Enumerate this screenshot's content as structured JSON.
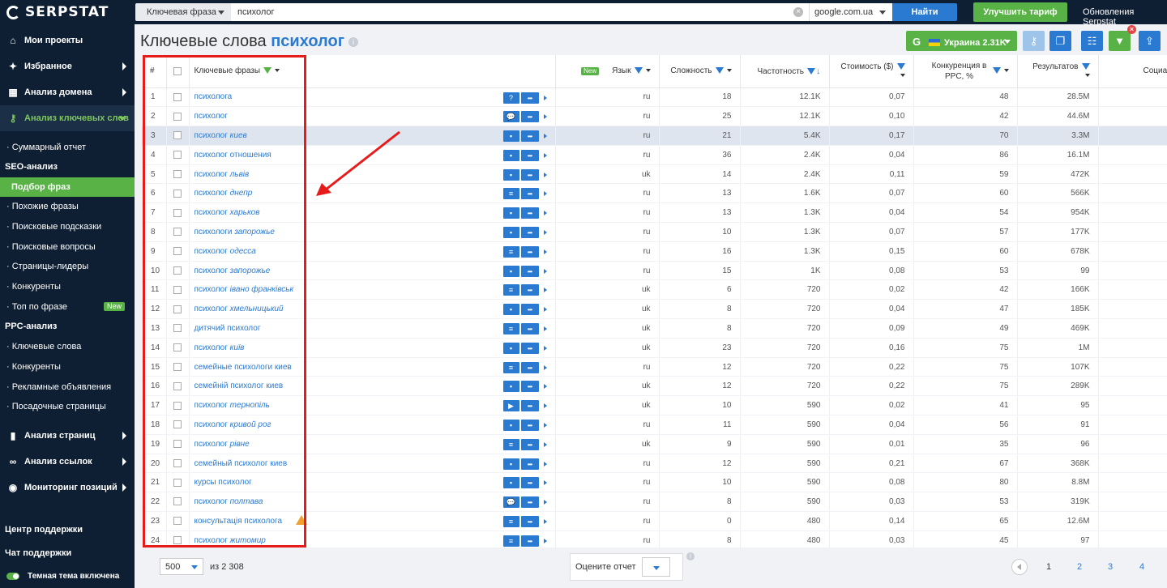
{
  "topbar": {
    "logo": "SERPSTAT",
    "search_type": "Ключевая фраза",
    "search_value": "психолог",
    "database": "google.com.ua",
    "find_label": "Найти",
    "upgrade_label": "Улучшить тариф",
    "updates_label": "Обновления Serpstat"
  },
  "sidebar": {
    "nav": [
      {
        "label": "Мои проекты",
        "icon": "home-icon"
      },
      {
        "label": "Избранное",
        "icon": "pin-icon"
      },
      {
        "label": "Анализ домена",
        "icon": "chart-icon"
      },
      {
        "label": "Анализ ключевых слов",
        "icon": "key-icon"
      }
    ],
    "keyword_items": [
      "Суммарный отчет",
      "SEO-анализ",
      "Подбор фраз",
      "Похожие фразы",
      "Поисковые подсказки",
      "Поисковые вопросы",
      "Страницы-лидеры",
      "Конкуренты",
      "Топ по фразе",
      "PPC-анализ",
      "Ключевые слова",
      "Конкуренты",
      "Рекламные объявления",
      "Посадочные страницы"
    ],
    "new_badge": "New",
    "nav2": [
      {
        "label": "Анализ страниц",
        "icon": "bar-icon"
      },
      {
        "label": "Анализ ссылок",
        "icon": "link-icon"
      },
      {
        "label": "Мониторинг позиций",
        "icon": "monitor-icon"
      }
    ],
    "support_center": "Центр поддержки",
    "support_chat": "Чат поддержки",
    "dark_theme": "Темная тема включена"
  },
  "header": {
    "title": "Ключевые слова",
    "keyword": "психолог",
    "region": "Украина 2.31K"
  },
  "table": {
    "columns": {
      "num": "#",
      "keyword": "Ключевые фразы",
      "new": "New",
      "lang": "Язык",
      "difficulty": "Сложность",
      "volume": "Частотность",
      "cost": "Стоимость ($)",
      "competition": "Конкуренция в PPC, %",
      "results": "Результатов",
      "social": "Социал"
    },
    "rows": [
      {
        "n": "1",
        "kw": "психолога",
        "lang": "ru",
        "diff": "18",
        "vol": "12.1K",
        "cost": "0,07",
        "comp": "48",
        "res": "28.5M",
        "a": "?"
      },
      {
        "n": "2",
        "kw": "психолог",
        "lang": "ru",
        "diff": "25",
        "vol": "12.1K",
        "cost": "0,10",
        "comp": "42",
        "res": "44.6M",
        "a": "💬"
      },
      {
        "n": "3",
        "kw": "психолог киев",
        "lang": "ru",
        "diff": "21",
        "vol": "5.4K",
        "cost": "0,17",
        "comp": "70",
        "res": "3.3M",
        "a": "▪"
      },
      {
        "n": "4",
        "kw": "психолог отношения",
        "lang": "ru",
        "diff": "36",
        "vol": "2.4K",
        "cost": "0,04",
        "comp": "86",
        "res": "16.1M",
        "a": "▪"
      },
      {
        "n": "5",
        "kw": "психолог львів",
        "lang": "uk",
        "diff": "14",
        "vol": "2.4K",
        "cost": "0,11",
        "comp": "59",
        "res": "472K",
        "a": "▪"
      },
      {
        "n": "6",
        "kw": "психолог днепр",
        "lang": "ru",
        "diff": "13",
        "vol": "1.6K",
        "cost": "0,07",
        "comp": "60",
        "res": "566K",
        "a": "≡"
      },
      {
        "n": "7",
        "kw": "психолог харьков",
        "lang": "ru",
        "diff": "13",
        "vol": "1.3K",
        "cost": "0,04",
        "comp": "54",
        "res": "954K",
        "a": "▪"
      },
      {
        "n": "8",
        "kw": "психологи запорожье",
        "lang": "ru",
        "diff": "10",
        "vol": "1.3K",
        "cost": "0,07",
        "comp": "57",
        "res": "177K",
        "a": "▪"
      },
      {
        "n": "9",
        "kw": "психолог одесса",
        "lang": "ru",
        "diff": "16",
        "vol": "1.3K",
        "cost": "0,15",
        "comp": "60",
        "res": "678K",
        "a": "≡"
      },
      {
        "n": "10",
        "kw": "психолог запорожье",
        "lang": "ru",
        "diff": "15",
        "vol": "1K",
        "cost": "0,08",
        "comp": "53",
        "res": "99",
        "a": "▪"
      },
      {
        "n": "11",
        "kw": "психолог івано франківськ",
        "lang": "uk",
        "diff": "6",
        "vol": "720",
        "cost": "0,02",
        "comp": "42",
        "res": "166K",
        "a": "≡"
      },
      {
        "n": "12",
        "kw": "психолог хмельницький",
        "lang": "uk",
        "diff": "8",
        "vol": "720",
        "cost": "0,04",
        "comp": "47",
        "res": "185K",
        "a": "▪"
      },
      {
        "n": "13",
        "kw": "дитячий психолог",
        "lang": "uk",
        "diff": "8",
        "vol": "720",
        "cost": "0,09",
        "comp": "49",
        "res": "469K",
        "a": "≡"
      },
      {
        "n": "14",
        "kw": "психолог київ",
        "lang": "uk",
        "diff": "23",
        "vol": "720",
        "cost": "0,16",
        "comp": "75",
        "res": "1M",
        "a": "▪"
      },
      {
        "n": "15",
        "kw": "семейные психологи киев",
        "lang": "ru",
        "diff": "12",
        "vol": "720",
        "cost": "0,22",
        "comp": "75",
        "res": "107K",
        "a": "≡"
      },
      {
        "n": "16",
        "kw": "семейній психолог киев",
        "lang": "uk",
        "diff": "12",
        "vol": "720",
        "cost": "0,22",
        "comp": "75",
        "res": "289K",
        "a": "▪"
      },
      {
        "n": "17",
        "kw": "психолог тернопіль",
        "lang": "uk",
        "diff": "10",
        "vol": "590",
        "cost": "0,02",
        "comp": "41",
        "res": "95",
        "a": "▶"
      },
      {
        "n": "18",
        "kw": "психолог кривой рог",
        "lang": "ru",
        "diff": "11",
        "vol": "590",
        "cost": "0,04",
        "comp": "56",
        "res": "91",
        "a": "▪"
      },
      {
        "n": "19",
        "kw": "психолог рівне",
        "lang": "uk",
        "diff": "9",
        "vol": "590",
        "cost": "0,01",
        "comp": "35",
        "res": "96",
        "a": "≡"
      },
      {
        "n": "20",
        "kw": "семейный психолог киев",
        "lang": "ru",
        "diff": "12",
        "vol": "590",
        "cost": "0,21",
        "comp": "67",
        "res": "368K",
        "a": "▪"
      },
      {
        "n": "21",
        "kw": "курсы психолог",
        "lang": "ru",
        "diff": "10",
        "vol": "590",
        "cost": "0,08",
        "comp": "80",
        "res": "8.8M",
        "a": "▪"
      },
      {
        "n": "22",
        "kw": "психолог полтава",
        "lang": "ru",
        "diff": "8",
        "vol": "590",
        "cost": "0,03",
        "comp": "53",
        "res": "319K",
        "a": "💬"
      },
      {
        "n": "23",
        "kw": "консультація психолога",
        "lang": "ru",
        "diff": "0",
        "vol": "480",
        "cost": "0,14",
        "comp": "65",
        "res": "12.6M",
        "a": "≡"
      },
      {
        "n": "24",
        "kw": "психолог житомир",
        "lang": "ru",
        "diff": "8",
        "vol": "480",
        "cost": "0,03",
        "comp": "45",
        "res": "97",
        "a": "≡"
      }
    ]
  },
  "footer": {
    "per_page": "500",
    "total": "из 2 308",
    "rate_label": "Оцените отчет",
    "pages": [
      "1",
      "2",
      "3",
      "4"
    ]
  },
  "colors": {
    "accent": "#2b7ad1",
    "green": "#58b245",
    "sidebar": "#0f1f33",
    "annotation": "#e81b1b"
  }
}
